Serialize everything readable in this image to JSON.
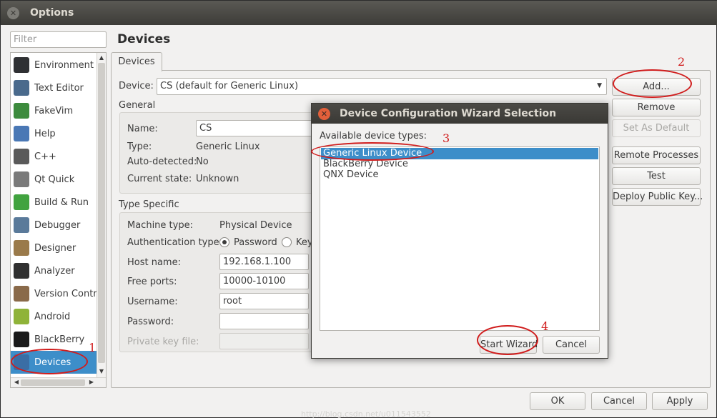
{
  "window": {
    "title": "Options"
  },
  "filter": {
    "placeholder": "Filter"
  },
  "page_title": "Devices",
  "sidebar": {
    "items": [
      {
        "label": "Environment",
        "icon": "environment-icon",
        "color": "#2f3033"
      },
      {
        "label": "Text Editor",
        "icon": "text-editor-icon",
        "color": "#4a6a8c"
      },
      {
        "label": "FakeVim",
        "icon": "fakevim-icon",
        "color": "#3d8b3d"
      },
      {
        "label": "Help",
        "icon": "help-icon",
        "color": "#4a78b5"
      },
      {
        "label": "C++",
        "icon": "cpp-icon",
        "color": "#5a5a5a"
      },
      {
        "label": "Qt Quick",
        "icon": "qt-quick-icon",
        "color": "#7a7a7a"
      },
      {
        "label": "Build & Run",
        "icon": "build-run-icon",
        "color": "#41a33f"
      },
      {
        "label": "Debugger",
        "icon": "debugger-icon",
        "color": "#5a7a9a"
      },
      {
        "label": "Designer",
        "icon": "designer-icon",
        "color": "#9a7a4a"
      },
      {
        "label": "Analyzer",
        "icon": "analyzer-icon",
        "color": "#303030"
      },
      {
        "label": "Version Control",
        "icon": "version-control-icon",
        "color": "#8a6a4a"
      },
      {
        "label": "Android",
        "icon": "android-icon",
        "color": "#8fb339"
      },
      {
        "label": "BlackBerry",
        "icon": "blackberry-icon",
        "color": "#1a1a1a"
      },
      {
        "label": "Devices",
        "icon": "devices-icon",
        "color": "#3a6ea5"
      }
    ]
  },
  "tab": {
    "label": "Devices"
  },
  "device_row": {
    "label": "Device:",
    "value": "CS (default for Generic Linux)"
  },
  "general": {
    "title": "General",
    "name_label": "Name:",
    "name_value": "CS",
    "type_label": "Type:",
    "type_value": "Generic Linux",
    "auto_label": "Auto-detected:",
    "auto_value": "No",
    "state_label": "Current state:",
    "state_value": "Unknown"
  },
  "type_specific": {
    "title": "Type Specific",
    "machine_label": "Machine type:",
    "machine_value": "Physical Device",
    "auth_label": "Authentication type:",
    "auth_password": "Password",
    "auth_key": "Key",
    "host_label": "Host name:",
    "host_value": "192.168.1.100",
    "ports_label": "Free ports:",
    "ports_value": "10000-10100",
    "user_label": "Username:",
    "user_value": "root",
    "pass_label": "Password:",
    "pass_value": "",
    "key_label": "Private key file:"
  },
  "buttons": {
    "add": "Add...",
    "remove": "Remove",
    "set_default": "Set As Default",
    "remote_processes": "Remote Processes",
    "test": "Test",
    "deploy_key": "Deploy Public Key..."
  },
  "dialog": {
    "title": "Device Configuration Wizard Selection",
    "available_label": "Available device types:",
    "items": [
      "Generic Linux Device",
      "BlackBerry Device",
      "QNX Device"
    ],
    "start_wizard": "Start Wizard",
    "cancel": "Cancel"
  },
  "footer": {
    "ok": "OK",
    "cancel": "Cancel",
    "apply": "Apply"
  },
  "annotations": {
    "n1": "1",
    "n2": "2",
    "n3": "3",
    "n4": "4"
  },
  "watermark": "http://blog.csdn.net/u011543552",
  "colors": {
    "accent": "#3d8ec9",
    "annotation": "#d01c1c",
    "titlebar": "#3d3c38"
  }
}
